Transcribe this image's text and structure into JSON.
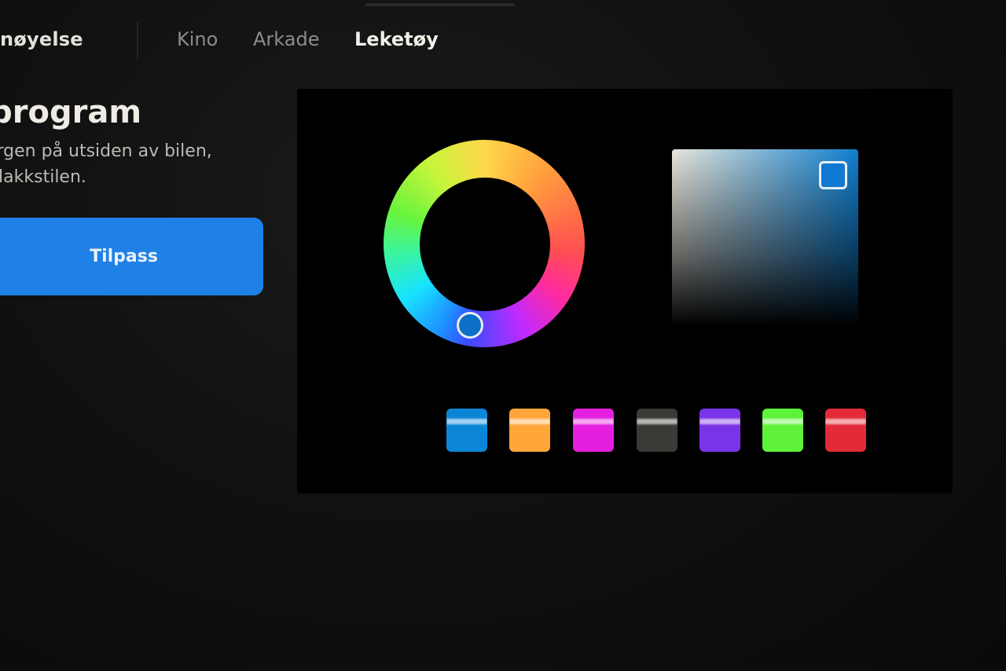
{
  "nav": {
    "section_title": "rnøyelse",
    "tabs": [
      {
        "label": "Kino",
        "active": false
      },
      {
        "label": "Arkade",
        "active": false
      },
      {
        "label": "Leketøy",
        "active": true
      }
    ]
  },
  "main": {
    "title": "eprogram",
    "description_line1": "argen på utsiden av bilen,",
    "description_line2": "r lakkstilen.",
    "customize_button": "Tilpass"
  },
  "color_picker": {
    "selected_color": "#1179d1",
    "swatches": [
      {
        "name": "blue",
        "color": "#0b86d6"
      },
      {
        "name": "orange",
        "color": "#ffa53a"
      },
      {
        "name": "magenta",
        "color": "#e51fe0"
      },
      {
        "name": "dark-gray",
        "color": "#3a3a36"
      },
      {
        "name": "purple",
        "color": "#7a34e8"
      },
      {
        "name": "green",
        "color": "#5ef23a"
      },
      {
        "name": "red",
        "color": "#e22a38"
      }
    ]
  }
}
